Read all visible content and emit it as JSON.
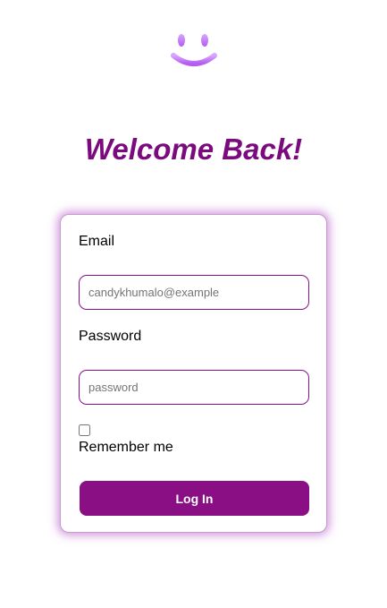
{
  "logo": {
    "icon": "smiley-icon",
    "color": "#c77dff"
  },
  "heading": {
    "title": "Welcome Back!"
  },
  "form": {
    "email_label": "Email",
    "email_placeholder": "candykhumalo@example",
    "password_label": "Password",
    "password_placeholder": "password",
    "remember_label": "Remember me",
    "remember_checked": false,
    "submit_label": "Log In"
  },
  "colors": {
    "accent": "#8a0f84",
    "title": "#7a0a7d",
    "glow": "#ae49c4"
  }
}
